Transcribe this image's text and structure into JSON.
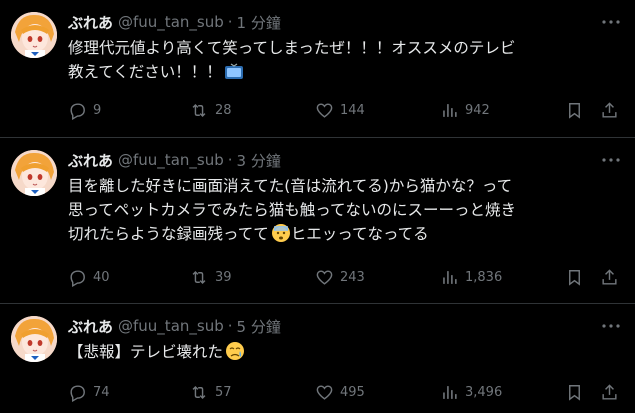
{
  "tweets": [
    {
      "name": "ぶれあ",
      "handle": "@fuu_tan_sub",
      "separator": "·",
      "time": "1 分鐘",
      "text": "修理代元値より高くて笑ってしまったぜ！！！オススメのテレビ\n教えてください！！！",
      "emoji": "tv-emoji",
      "replies": "9",
      "retweets": "28",
      "likes": "144",
      "views": "942"
    },
    {
      "name": "ぶれあ",
      "handle": "@fuu_tan_sub",
      "separator": "·",
      "time": "3 分鐘",
      "text": "目を離した好きに画面消えてた(音は流れてる)から猫かな？って\n思ってペットカメラでみたら猫も触ってないのにスーーっと焼き\n切れたらような録画残ってて",
      "text_after": "ヒエッってなってる",
      "emoji": "anxious-face-emoji",
      "replies": "40",
      "retweets": "39",
      "likes": "243",
      "views": "1,836"
    },
    {
      "name": "ぶれあ",
      "handle": "@fuu_tan_sub",
      "separator": "·",
      "time": "5 分鐘",
      "text": "【悲報】テレビ壊れた",
      "emoji": "crying-face-emoji",
      "replies": "74",
      "retweets": "57",
      "likes": "495",
      "views": "3,496"
    }
  ],
  "colors": {
    "background": "#000000",
    "text": "#e7e9ea",
    "muted": "#71767b",
    "divider": "#2f3336"
  }
}
